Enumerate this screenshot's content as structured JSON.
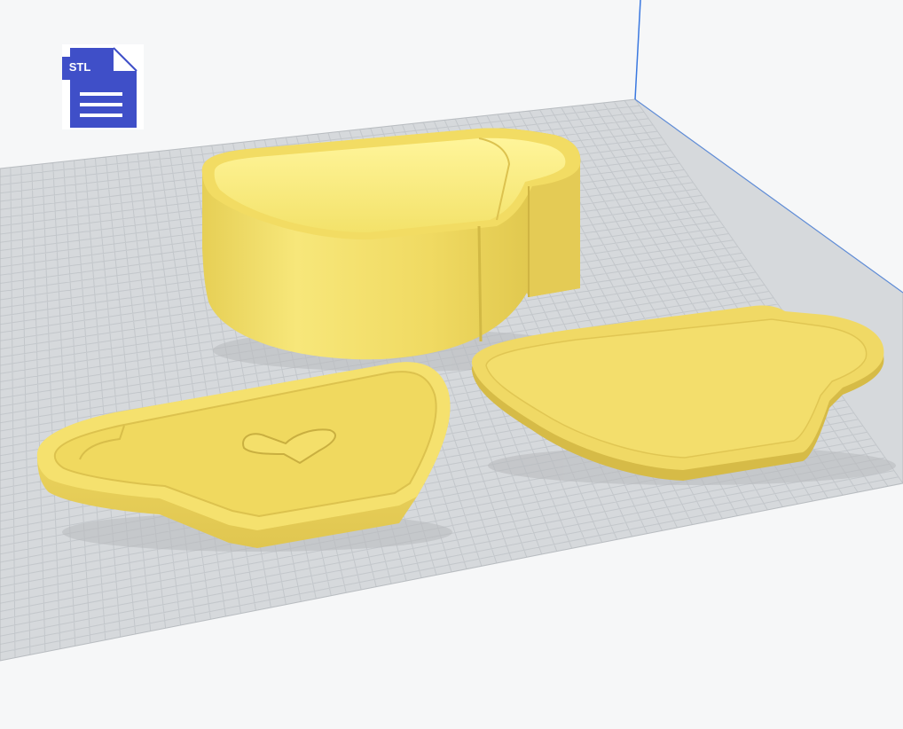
{
  "file_badge": {
    "icon": "stl-file-icon",
    "label": "STL",
    "color": "#3f4fc8"
  },
  "scene": {
    "build_plate_color": "#d6d9dc",
    "grid_line_color": "#c6cacd",
    "model_color": "#f2e06a",
    "model_shadow_color": "#c8b34a",
    "axis_color": "#3a78e0",
    "objects": [
      {
        "name": "teacup-box-body"
      },
      {
        "name": "teacup-lid"
      },
      {
        "name": "teacup-base"
      }
    ]
  }
}
